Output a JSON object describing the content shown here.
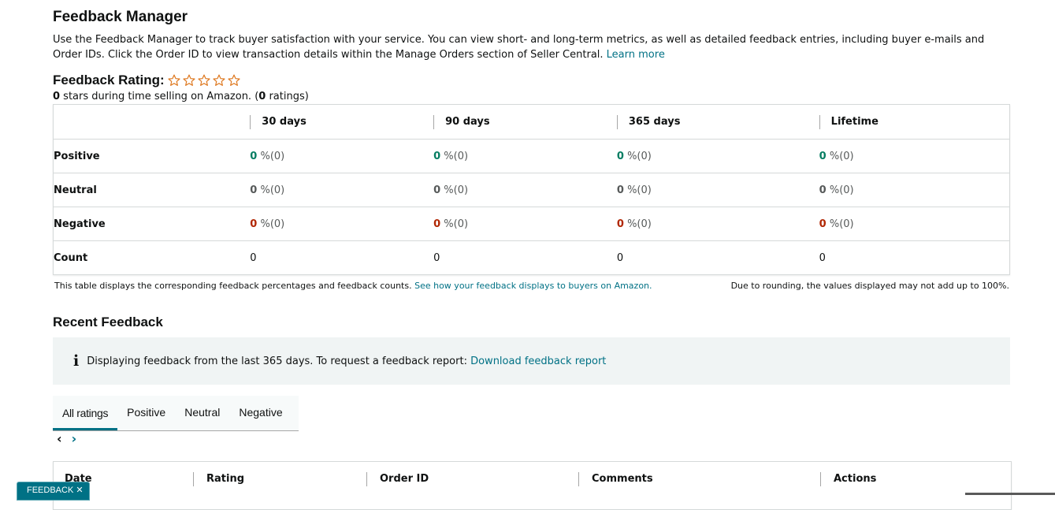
{
  "header": {
    "title": "Feedback Manager",
    "intro": "Use the Feedback Manager to track buyer satisfaction with your service. You can view short- and long-term metrics, as well as detailed feedback entries, including buyer e-mails and Order IDs. Click the Order ID to view transaction details within the Manage Orders section of Seller Central.",
    "learn_more": "Learn more"
  },
  "rating": {
    "title": "Feedback Rating:",
    "stars_value": "0",
    "stars_text": " stars during time selling on Amazon. (",
    "ratings_count": "0",
    "ratings_text": " ratings)",
    "star_color": "#de7921"
  },
  "metrics": {
    "columns": [
      "30 days",
      "90 days",
      "365 days",
      "Lifetime"
    ],
    "rows": [
      {
        "label": "Positive",
        "cells": [
          {
            "num": "0",
            "rest": " %(0)"
          },
          {
            "num": "0",
            "rest": " %(0)"
          },
          {
            "num": "0",
            "rest": " %(0)"
          },
          {
            "num": "0",
            "rest": " %(0)"
          }
        ]
      },
      {
        "label": "Neutral",
        "cells": [
          {
            "num": "0",
            "rest": " %(0)"
          },
          {
            "num": "0",
            "rest": " %(0)"
          },
          {
            "num": "0",
            "rest": " %(0)"
          },
          {
            "num": "0",
            "rest": " %(0)"
          }
        ]
      },
      {
        "label": "Negative",
        "cells": [
          {
            "num": "0",
            "rest": " %(0)"
          },
          {
            "num": "0",
            "rest": " %(0)"
          },
          {
            "num": "0",
            "rest": " %(0)"
          },
          {
            "num": "0",
            "rest": " %(0)"
          }
        ]
      },
      {
        "label": "Count",
        "cells": [
          "0",
          "0",
          "0",
          "0"
        ]
      }
    ],
    "note_left": "This table displays the corresponding feedback percentages and feedback counts.",
    "note_link": "See how your feedback displays to buyers on Amazon.",
    "note_right": "Due to rounding, the values displayed may not add up to 100%."
  },
  "recent": {
    "title": "Recent Feedback",
    "info_icon": "i",
    "info_text": "Displaying feedback from the last 365 days. To request a feedback report:",
    "info_link": "Download feedback report",
    "tabs": [
      "All ratings",
      "Positive",
      "Neutral",
      "Negative"
    ],
    "pager_prev": "‹",
    "pager_next": "›",
    "columns": [
      "Date",
      "Rating",
      "Order ID",
      "Comments",
      "Actions"
    ]
  },
  "feedback_button": "FEEDBACK ✕",
  "colors": {
    "link": "#007185",
    "positive": "#067d62",
    "negative": "#b12704",
    "info_bg": "#f0f4f4"
  }
}
